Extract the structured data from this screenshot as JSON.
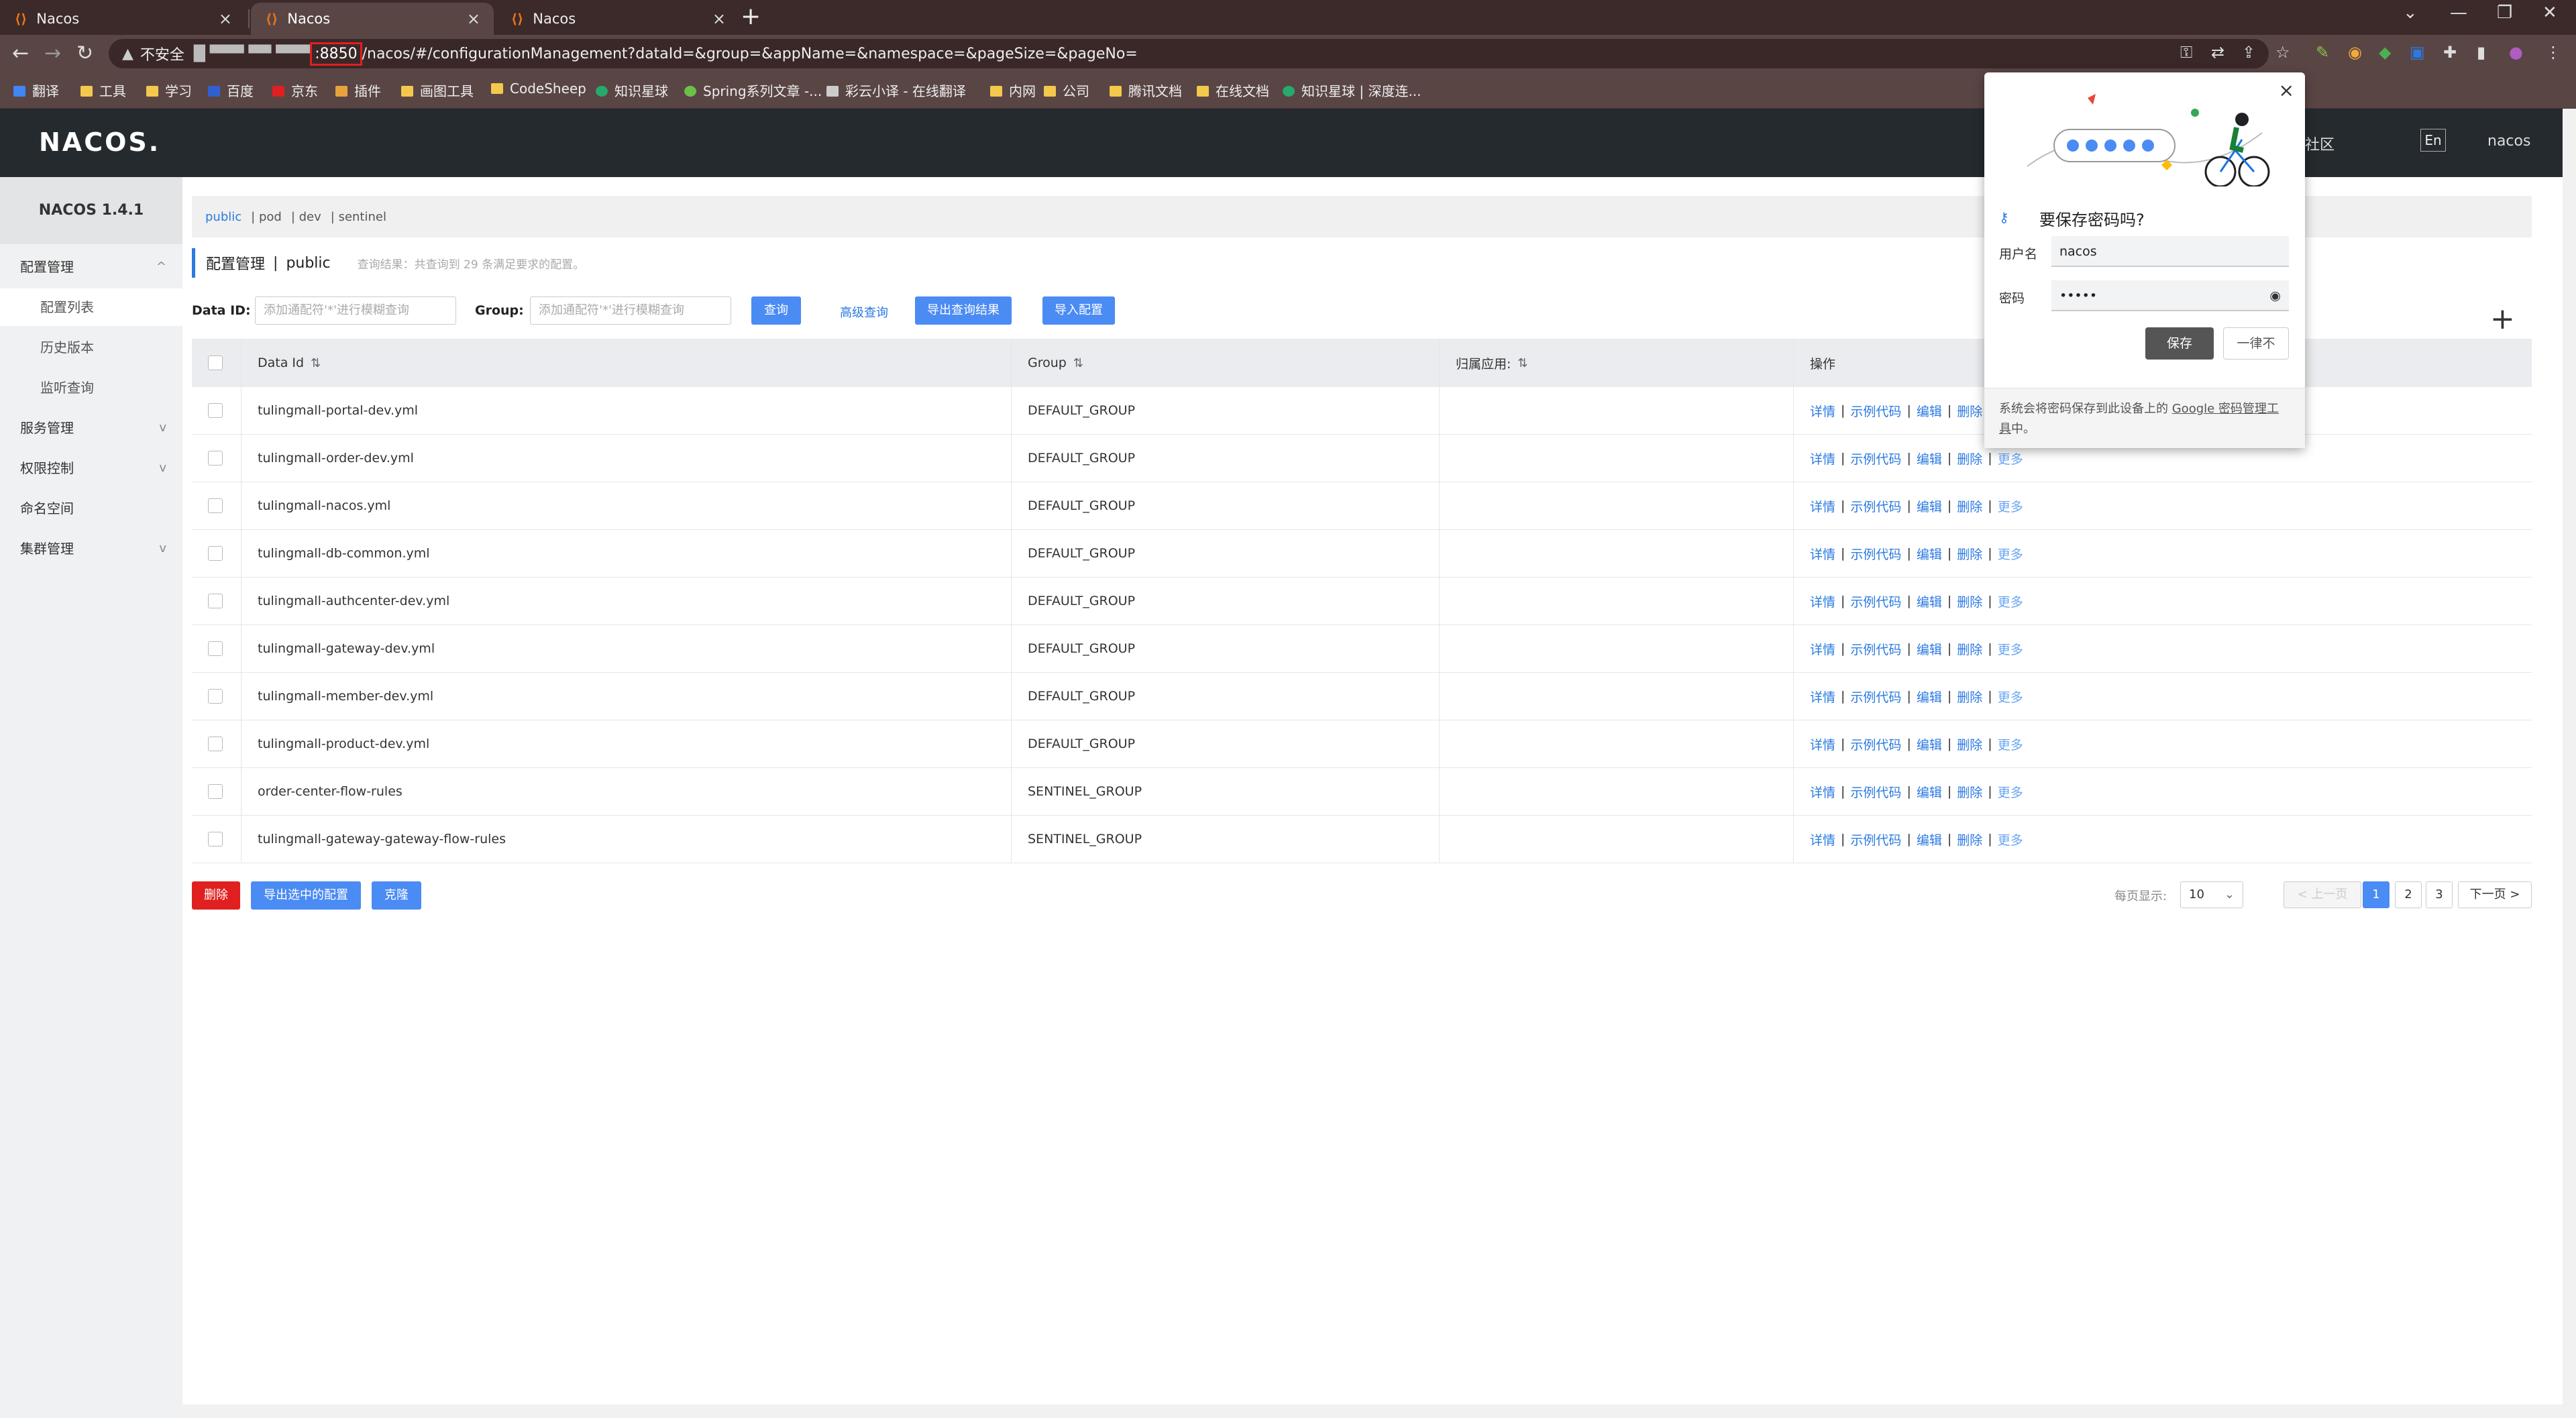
{
  "tabs": [
    {
      "title": "Nacos",
      "active": false
    },
    {
      "title": "Nacos",
      "active": true
    },
    {
      "title": "Nacos",
      "active": false
    }
  ],
  "omnibox": {
    "security": "不安全",
    "host_masked": "█ ▀▀▀ ▀▀ ▀▀▀",
    "port": ":8850",
    "path": "/nacos/#/configurationManagement?dataId=&group=&appName=&namespace=&pageSize=&pageNo="
  },
  "bookmarks": [
    "翻译",
    "工具",
    "学习",
    "百度",
    "京东",
    "插件",
    "画图工具",
    "CodeSheep",
    "知识星球",
    "Spring系列文章 -...",
    "彩云小译 - 在线翻译",
    "内网",
    "公司",
    "腾讯文档",
    "在线文档",
    "知识星球 | 深度连..."
  ],
  "header": {
    "logo": "NACOS.",
    "links": [
      "社区"
    ],
    "lang": "En",
    "user": "nacos"
  },
  "sidebar": {
    "version": "NACOS 1.4.1",
    "items": [
      {
        "label": "配置管理",
        "type": "group",
        "chev": "^"
      },
      {
        "label": "配置列表",
        "type": "sub",
        "active": true
      },
      {
        "label": "历史版本",
        "type": "sub"
      },
      {
        "label": "监听查询",
        "type": "sub"
      },
      {
        "label": "服务管理",
        "type": "group",
        "chev": "v"
      },
      {
        "label": "权限控制",
        "type": "group",
        "chev": "v"
      },
      {
        "label": "命名空间",
        "type": "group"
      },
      {
        "label": "集群管理",
        "type": "group",
        "chev": "v"
      }
    ]
  },
  "namespaces": [
    "public",
    "| pod",
    "| dev",
    "| sentinel"
  ],
  "page_title": {
    "title": "配置管理",
    "sep": "|",
    "namespace": "public",
    "hint": "查询结果：共查询到 29 条满足要求的配置。"
  },
  "filters": {
    "dataid_label": "Data ID:",
    "dataid_placeholder": "添加通配符'*'进行模糊查询",
    "group_label": "Group:",
    "group_placeholder": "添加通配符'*'进行模糊查询",
    "query": "查询",
    "advanced": "高级查询",
    "export_results": "导出查询结果",
    "import": "导入配置"
  },
  "table": {
    "columns": [
      "Data Id",
      "Group",
      "归属应用:",
      "操作"
    ],
    "ops": [
      "详情",
      "示例代码",
      "编辑",
      "删除",
      "更多"
    ],
    "rows": [
      {
        "data_id": "tulingmall-portal-dev.yml",
        "group": "DEFAULT_GROUP"
      },
      {
        "data_id": "tulingmall-order-dev.yml",
        "group": "DEFAULT_GROUP"
      },
      {
        "data_id": "tulingmall-nacos.yml",
        "group": "DEFAULT_GROUP"
      },
      {
        "data_id": "tulingmall-db-common.yml",
        "group": "DEFAULT_GROUP"
      },
      {
        "data_id": "tulingmall-authcenter-dev.yml",
        "group": "DEFAULT_GROUP"
      },
      {
        "data_id": "tulingmall-gateway-dev.yml",
        "group": "DEFAULT_GROUP"
      },
      {
        "data_id": "tulingmall-member-dev.yml",
        "group": "DEFAULT_GROUP"
      },
      {
        "data_id": "tulingmall-product-dev.yml",
        "group": "DEFAULT_GROUP"
      },
      {
        "data_id": "order-center-flow-rules",
        "group": "SENTINEL_GROUP"
      },
      {
        "data_id": "tulingmall-gateway-gateway-flow-rules",
        "group": "SENTINEL_GROUP"
      }
    ]
  },
  "bottom": {
    "delete": "删除",
    "export_selected": "导出选中的配置",
    "clone": "克隆"
  },
  "pagination": {
    "per_page_label": "每页显示:",
    "per_page": "10",
    "prev": "< 上一页",
    "pages": [
      "1",
      "2",
      "3"
    ],
    "current": "1",
    "next": "下一页 >"
  },
  "password_popup": {
    "title": "要保存密码吗?",
    "username_label": "用户名",
    "username": "nacos",
    "password_label": "密码",
    "password": "•••••",
    "save": "保存",
    "never": "一律不",
    "footer_prefix": "系统会将密码保存到此设备上的",
    "footer_link": "Google 密码管理工具",
    "footer_suffix": "中。"
  },
  "colors": {
    "accent": "#4b8bf4",
    "danger": "#e02020",
    "header_bg": "#252a2f"
  }
}
